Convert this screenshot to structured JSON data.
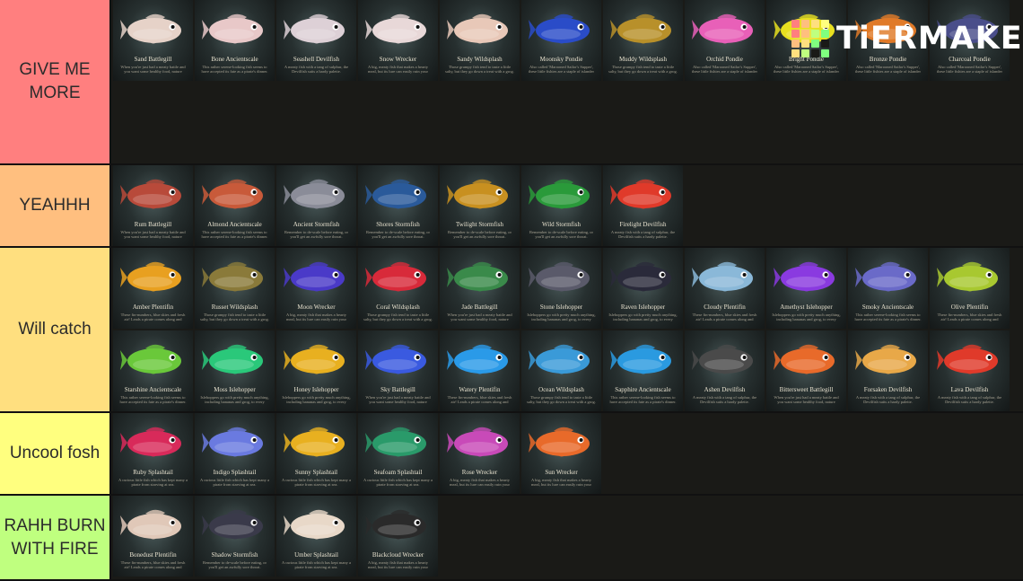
{
  "logo": {
    "text": "TiERMAKER",
    "grid_colors": [
      "#ff7f7f",
      "#ffbf7f",
      "#ffdf7f",
      "#ffff7f",
      "#ff7f7f",
      "#ffbf7f",
      "#bfff7f",
      "#7fff7f",
      "#ffbf7f",
      "#ffdf7f",
      "#7fff7f",
      "#1a1a17",
      "#ffdf7f",
      "#bfff7f",
      "#1a1a17",
      "#7fff7f"
    ]
  },
  "tiers": [
    {
      "label": "GIVE ME MORE",
      "color": "#ff7f7f",
      "items": [
        {
          "name": "Sand Battlegill",
          "color": "#e6d2c8",
          "desc": "When you're just had a meaty battle and you want some healthy food, nature provides."
        },
        {
          "name": "Bone Ancientscale",
          "color": "#e8c8c8",
          "desc": "This rather serene-looking fish seems to have accepted its fate as a pirate's dinner."
        },
        {
          "name": "Seashell Devilfish",
          "color": "#ddd0d6",
          "desc": "A meaty fish with a tang of sulphur, the Devilfish suits a hardy palette."
        },
        {
          "name": "Snow Wrecker",
          "color": "#e8d8d8",
          "desc": "A big, meaty fish that makes a hearty meal, but its lure can easily ruin your appetite."
        },
        {
          "name": "Sandy Wildsplash",
          "color": "#e8c8b8",
          "desc": "Those grumpy fish tend to taste a little salty, but they go down a treat with a grog."
        },
        {
          "name": "Moonsky Pondie",
          "color": "#2a4cc8",
          "desc": "Also called 'Marooned Sailor's Supper', these little fishies are a staple of islander diets."
        },
        {
          "name": "Muddy Wildsplash",
          "color": "#b8902a",
          "desc": "Those grumpy fish tend to taste a little salty, but they go down a treat with a grog."
        },
        {
          "name": "Orchid Pondie",
          "color": "#e860b8",
          "desc": "Also called 'Marooned Sailor's Supper', these little fishies are a staple of islander diets."
        },
        {
          "name": "Bright Pondie",
          "color": "#e8e020",
          "desc": "Also called 'Marooned Sailor's Supper', these little fishies are a staple of islander diets."
        },
        {
          "name": "Bronze Pondie",
          "color": "#e07a28",
          "desc": "Also called 'Marooned Sailor's Supper', these little fishies are a staple of islander diets."
        },
        {
          "name": "Charcoal Pondie",
          "color": "#4a4e8a",
          "desc": "Also called 'Marooned Sailor's Supper', these little fishies are a staple of islander diets."
        }
      ]
    },
    {
      "label": "YEAHHH",
      "color": "#ffbf7f",
      "items": [
        {
          "name": "Rum Battlegill",
          "color": "#b84a3a",
          "desc": "When you're just had a meaty battle and you want some healthy food, nature provides."
        },
        {
          "name": "Almond Ancientscale",
          "color": "#c85a3a",
          "desc": "This rather serene-looking fish seems to have accepted its fate as a pirate's dinner."
        },
        {
          "name": "Ancient Stormfish",
          "color": "#8a8c98",
          "desc": "Remember to de-scale before eating, or you'll get an awfully sore throat."
        },
        {
          "name": "Shores Stormfish",
          "color": "#2a5a9a",
          "desc": "Remember to de-scale before eating, or you'll get an awfully sore throat."
        },
        {
          "name": "Twilight Stormfish",
          "color": "#c89020",
          "desc": "Remember to de-scale before eating, or you'll get an awfully sore throat."
        },
        {
          "name": "Wild Stormfish",
          "color": "#2a9a3a",
          "desc": "Remember to de-scale before eating, or you'll get an awfully sore throat."
        },
        {
          "name": "Firelight Devilfish",
          "color": "#e03a2a",
          "desc": "A meaty fish with a tang of sulphur, the Devilfish suits a hardy palette."
        }
      ]
    },
    {
      "label": "Will catch",
      "color": "#ffdf7f",
      "items": [
        {
          "name": "Amber Plentifin",
          "color": "#e8a020",
          "desc": "These fin-numbers, blue skies and fresh air! Leads a pirate comes along and"
        },
        {
          "name": "Russet Wildsplash",
          "color": "#8a7a3a",
          "desc": "Those grumpy fish tend to taste a little salty, but they go down a treat with a grog."
        },
        {
          "name": "Moon Wrecker",
          "color": "#4a3ac8",
          "desc": "A big, meaty fish that makes a hearty meal, but its lure can easily ruin your appetite."
        },
        {
          "name": "Coral Wildsplash",
          "color": "#d82a3a",
          "desc": "Those grumpy fish tend to taste a little salty, but they go down a treat with a grog."
        },
        {
          "name": "Jade Battlegill",
          "color": "#3a8a4a",
          "desc": "When you're just had a meaty battle and you want some healthy food, nature provides."
        },
        {
          "name": "Stone Islehopper",
          "color": "#5a5a6a",
          "desc": "Islehoppers go with pretty much anything, including bananas and grog, to every pirates'"
        },
        {
          "name": "Raven Islehopper",
          "color": "#2a2a3a",
          "desc": "Islehoppers go with pretty much anything, including bananas and grog, to every pirates'"
        },
        {
          "name": "Cloudy Plentifin",
          "color": "#8ab8d8",
          "desc": "These fin-numbers, blue skies and fresh air! Leads a pirate comes along and"
        },
        {
          "name": "Amethyst Islehopper",
          "color": "#8a3ae0",
          "desc": "Islehoppers go with pretty much anything, including bananas and grog, to every pirates'"
        },
        {
          "name": "Smoky Ancientscale",
          "color": "#6a6ac8",
          "desc": "This rather serene-looking fish seems to have accepted its fate as a pirate's dinner."
        },
        {
          "name": "Olive Plentifin",
          "color": "#a8c830",
          "desc": "These fin-numbers, blue skies and fresh air! Leads a pirate comes along and"
        },
        {
          "name": "Starshine Ancientscale",
          "color": "#6ac83a",
          "desc": "This rather serene-looking fish seems to have accepted its fate as a pirate's dinner."
        },
        {
          "name": "Moss Islehopper",
          "color": "#2ac87a",
          "desc": "Islehoppers go with pretty much anything, including bananas and grog, to every pirates'"
        },
        {
          "name": "Honey Islehopper",
          "color": "#e8b020",
          "desc": "Islehoppers go with pretty much anything, including bananas and grog, to every pirates'"
        },
        {
          "name": "Sky Battlegill",
          "color": "#3a5ae0",
          "desc": "When you're just had a meaty battle and you want some healthy food, nature provides."
        },
        {
          "name": "Watery Plentifin",
          "color": "#2a9ae8",
          "desc": "These fin-numbers, blue skies and fresh air! Leads a pirate comes along and"
        },
        {
          "name": "Ocean Wildsplash",
          "color": "#3a9ad8",
          "desc": "Those grumpy fish tend to taste a little salty, but they go down a treat with a grog."
        },
        {
          "name": "Sapphire Ancientscale",
          "color": "#2a9ae0",
          "desc": "This rather serene-looking fish seems to have accepted its fate as a pirate's dinner."
        },
        {
          "name": "Ashen Devilfish",
          "color": "#4a4a4a",
          "desc": "A meaty fish with a tang of sulphur, the Devilfish suits a hardy palette."
        },
        {
          "name": "Bittersweet Battlegill",
          "color": "#e86a2a",
          "desc": "When you're just had a meaty battle and you want some healthy food, nature provides."
        },
        {
          "name": "Forsaken Devilfish",
          "color": "#e8a848",
          "desc": "A meaty fish with a tang of sulphur, the Devilfish suits a hardy palette."
        },
        {
          "name": "Lava Devilfish",
          "color": "#e03a2a",
          "desc": "A meaty fish with a tang of sulphur, the Devilfish suits a hardy palette."
        }
      ]
    },
    {
      "label": "Uncool fosh",
      "color": "#ffff7f",
      "items": [
        {
          "name": "Ruby Splashtail",
          "color": "#d82a5a",
          "desc": "A curious little fish which has kept many a pirate from starving at sea."
        },
        {
          "name": "Indigo Splashtail",
          "color": "#6a7ae0",
          "desc": "A curious little fish which has kept many a pirate from starving at sea."
        },
        {
          "name": "Sunny Splashtail",
          "color": "#e8b020",
          "desc": "A curious little fish which has kept many a pirate from starving at sea."
        },
        {
          "name": "Seafoam Splashtail",
          "color": "#2a9a6a",
          "desc": "A curious little fish which has kept many a pirate from starving at sea."
        },
        {
          "name": "Rose Wrecker",
          "color": "#c84ab8",
          "desc": "A big, meaty fish that makes a hearty meal, but its lure can easily ruin your appetite."
        },
        {
          "name": "Sun Wrecker",
          "color": "#e86a2a",
          "desc": "A big, meaty fish that makes a hearty meal, but its lure can easily ruin your appetite."
        }
      ]
    },
    {
      "label": "RAHH BURN WITH FIRE",
      "color": "#bfff7f",
      "items": [
        {
          "name": "Bonedust Plentifin",
          "color": "#e0c8b8",
          "desc": "These fin-numbers, blue skies and fresh air! Leads a pirate comes along and"
        },
        {
          "name": "Shadow Stormfish",
          "color": "#3a3a4a",
          "desc": "Remember to de-scale before eating, or you'll get an awfully sore throat."
        },
        {
          "name": "Umber Splashtail",
          "color": "#e8d8c8",
          "desc": "A curious little fish which has kept many a pirate from starving at sea."
        },
        {
          "name": "Blackcloud Wrecker",
          "color": "#2a2a2a",
          "desc": "A big, meaty fish that makes a hearty meal, but its lure can easily ruin your appetite."
        }
      ]
    }
  ]
}
